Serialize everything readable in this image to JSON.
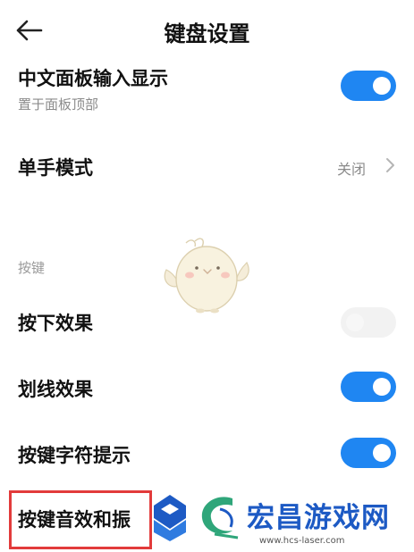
{
  "header": {
    "title": "键盘设置"
  },
  "rows": {
    "chinese_panel": {
      "title": "中文面板输入显示",
      "subtitle": "置于面板顶部",
      "toggle_on": true
    },
    "one_hand": {
      "title": "单手模式",
      "value": "关闭"
    },
    "section_keys": "按键",
    "press_effect": {
      "title": "按下效果",
      "toggle_on": false
    },
    "swipe_effect": {
      "title": "划线效果",
      "toggle_on": true
    },
    "char_hint": {
      "title": "按键字符提示",
      "toggle_on": true
    },
    "sound_vibe": {
      "title": "按键音效和振"
    }
  },
  "watermark": {
    "text": "宏昌游戏网",
    "url": "www.hcs-laser.com"
  },
  "colors": {
    "accent": "#1f86f2",
    "highlight": "#e23b3b",
    "watermark_blue": "#1d5ac4",
    "watermark_green": "#2fa67a"
  }
}
